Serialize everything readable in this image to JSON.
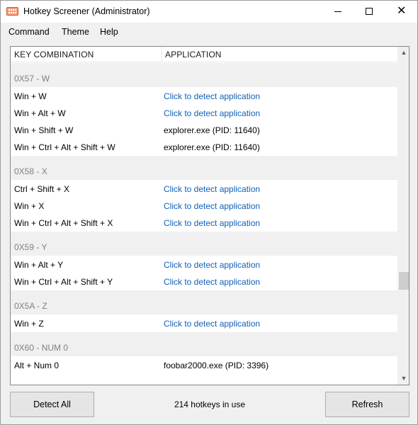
{
  "window": {
    "title": "Hotkey Screener (Administrator)",
    "close_glyph": "✕"
  },
  "menu": {
    "items": [
      "Command",
      "Theme",
      "Help"
    ]
  },
  "list": {
    "columns": [
      "KEY COMBINATION",
      "APPLICATION"
    ],
    "entries": [
      {
        "kind": "group",
        "label": "0X57 - W"
      },
      {
        "kind": "row",
        "key": "Win + W",
        "app": "Click to detect application",
        "link": true
      },
      {
        "kind": "row",
        "key": "Win + Alt + W",
        "app": "Click to detect application",
        "link": true
      },
      {
        "kind": "row",
        "key": "Win + Shift + W",
        "app": "explorer.exe (PID: 11640)",
        "link": false
      },
      {
        "kind": "row",
        "key": "Win + Ctrl + Alt + Shift + W",
        "app": "explorer.exe (PID: 11640)",
        "link": false
      },
      {
        "kind": "group",
        "label": "0X58 - X"
      },
      {
        "kind": "row",
        "key": "Ctrl + Shift + X",
        "app": "Click to detect application",
        "link": true
      },
      {
        "kind": "row",
        "key": "Win + X",
        "app": "Click to detect application",
        "link": true
      },
      {
        "kind": "row",
        "key": "Win + Ctrl + Alt + Shift + X",
        "app": "Click to detect application",
        "link": true
      },
      {
        "kind": "group",
        "label": "0X59 - Y"
      },
      {
        "kind": "row",
        "key": "Win + Alt + Y",
        "app": "Click to detect application",
        "link": true
      },
      {
        "kind": "row",
        "key": "Win + Ctrl + Alt + Shift + Y",
        "app": "Click to detect application",
        "link": true
      },
      {
        "kind": "group",
        "label": "0X5A - Z"
      },
      {
        "kind": "row",
        "key": "Win + Z",
        "app": "Click to detect application",
        "link": true
      },
      {
        "kind": "group",
        "label": "0X60 - NUM 0"
      },
      {
        "kind": "row",
        "key": "Alt + Num 0",
        "app": "foobar2000.exe (PID: 3396)",
        "link": false
      }
    ],
    "scroll_position": 0.72
  },
  "footer": {
    "detect_all_label": "Detect All",
    "status_text": "214 hotkeys in use",
    "refresh_label": "Refresh"
  },
  "colors": {
    "link": "#1060b8",
    "group_label": "#808080",
    "group_bg": "#f0f0f0"
  }
}
